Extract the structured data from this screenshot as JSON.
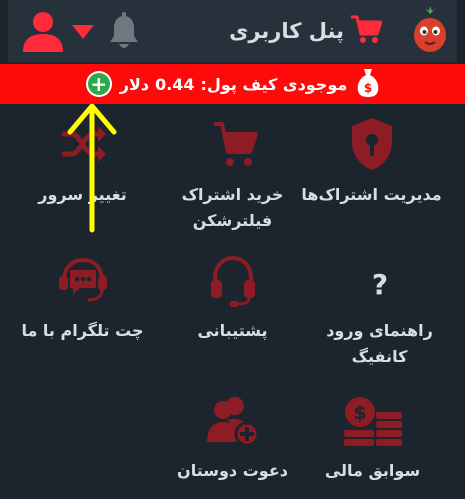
{
  "header": {
    "title": "پنل کاربری",
    "icons": [
      "tomato-logo-icon",
      "cart-icon",
      "bell-icon",
      "user-icon",
      "caret-down-icon"
    ]
  },
  "balance": {
    "label": "موجودی کیف پول:",
    "amount": "0.44",
    "unit": "دلار",
    "icons": [
      "money-bag-icon",
      "add-funds-icon"
    ]
  },
  "menu": [
    {
      "label": "مدیریت اشتراک‌ها",
      "icon": "shield-icon"
    },
    {
      "label": "خرید اشتراک فیلترشکن",
      "icon": "cart-icon"
    },
    {
      "label": "تغییر سرور",
      "icon": "shuffle-icon"
    },
    {
      "label": "راهنمای ورود کانفیگ",
      "icon": "question-icon"
    },
    {
      "label": "پشتیبانی",
      "icon": "headset-icon"
    },
    {
      "label": "چت تلگرام با ما",
      "icon": "chat-headset-icon"
    },
    {
      "label": "سوابق مالی",
      "icon": "money-stack-icon"
    },
    {
      "label": "دعوت دوستان",
      "icon": "invite-users-icon"
    }
  ],
  "colors": {
    "background": "#1c252d",
    "header": "#27313b",
    "balance_bar": "#ff0a0a",
    "icon_red": "#8d1c25",
    "text": "#d6dde3",
    "arrow": "#ffff00",
    "add_button": "#2fa84a"
  }
}
